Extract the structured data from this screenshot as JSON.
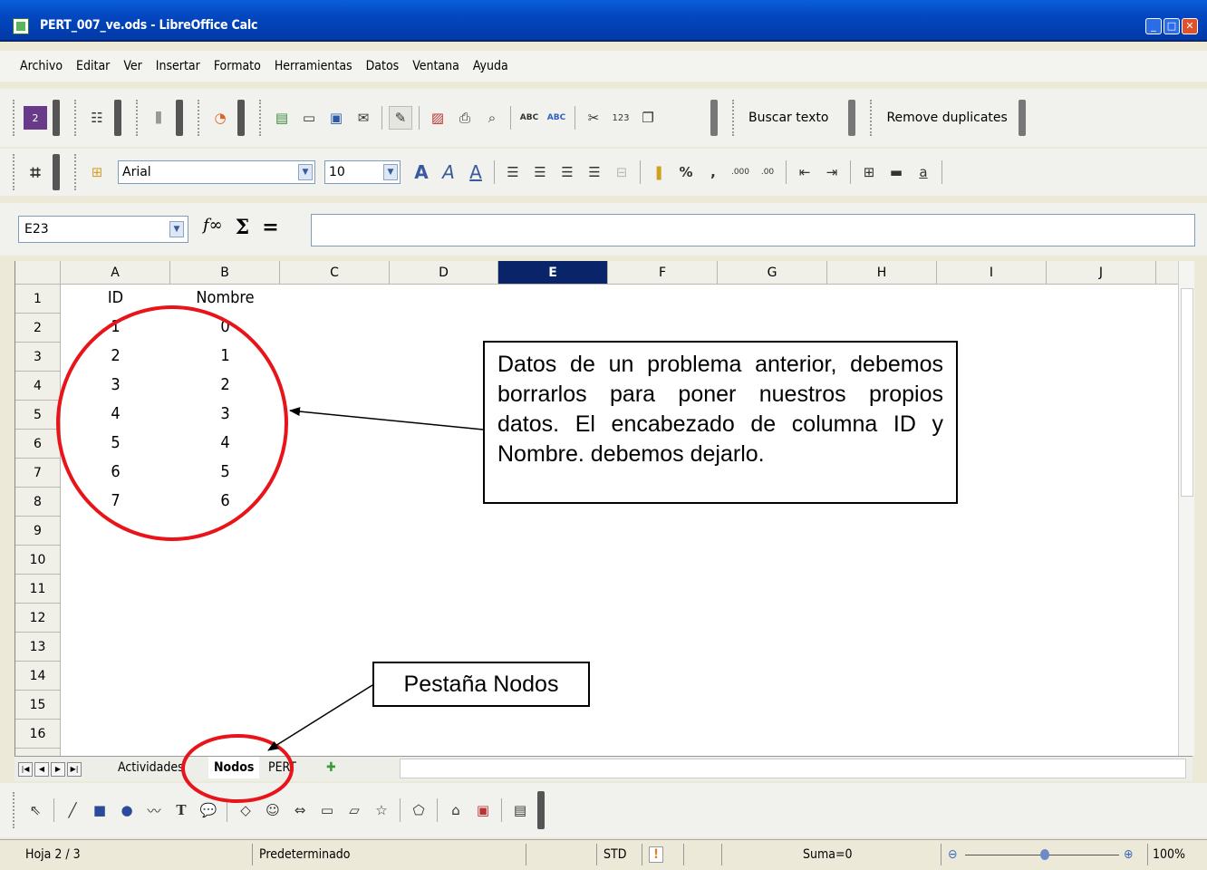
{
  "window": {
    "title": "PERT_007_ve.ods - LibreOffice Calc"
  },
  "menu": [
    "Archivo",
    "Editar",
    "Ver",
    "Insertar",
    "Formato",
    "Herramientas",
    "Datos",
    "Ventana",
    "Ayuda"
  ],
  "toolbar": {
    "find_text": "Buscar texto",
    "remove_duplicates": "Remove duplicates"
  },
  "format": {
    "font": "Arial",
    "size": "10"
  },
  "formula": {
    "cell_ref": "E23",
    "value": ""
  },
  "columns": [
    "A",
    "B",
    "C",
    "D",
    "E",
    "F",
    "G",
    "H",
    "I",
    "J"
  ],
  "selected_column": "E",
  "rows": [
    "1",
    "2",
    "3",
    "4",
    "5",
    "6",
    "7",
    "8",
    "9",
    "10",
    "11",
    "12",
    "13",
    "14",
    "15",
    "16"
  ],
  "cells": {
    "A": [
      "ID",
      "1",
      "2",
      "3",
      "4",
      "5",
      "6",
      "7"
    ],
    "B": [
      "Nombre",
      "0",
      "1",
      "2",
      "3",
      "4",
      "5",
      "6"
    ]
  },
  "annotations": {
    "data_note": "Datos de un problema anterior, debemos borrarlos para poner nuestros propios datos. El encabezado de columna ID y Nombre. debemos dejarlo.",
    "tab_note": "Pestaña Nodos"
  },
  "sheets": [
    "Actividades",
    "Nodos",
    "PERT"
  ],
  "active_sheet": "Nodos",
  "status": {
    "sheet": "Hoja 2 / 3",
    "style": "Predeterminado",
    "mode": "STD",
    "sum": "Suma=0",
    "zoom": "100%"
  }
}
